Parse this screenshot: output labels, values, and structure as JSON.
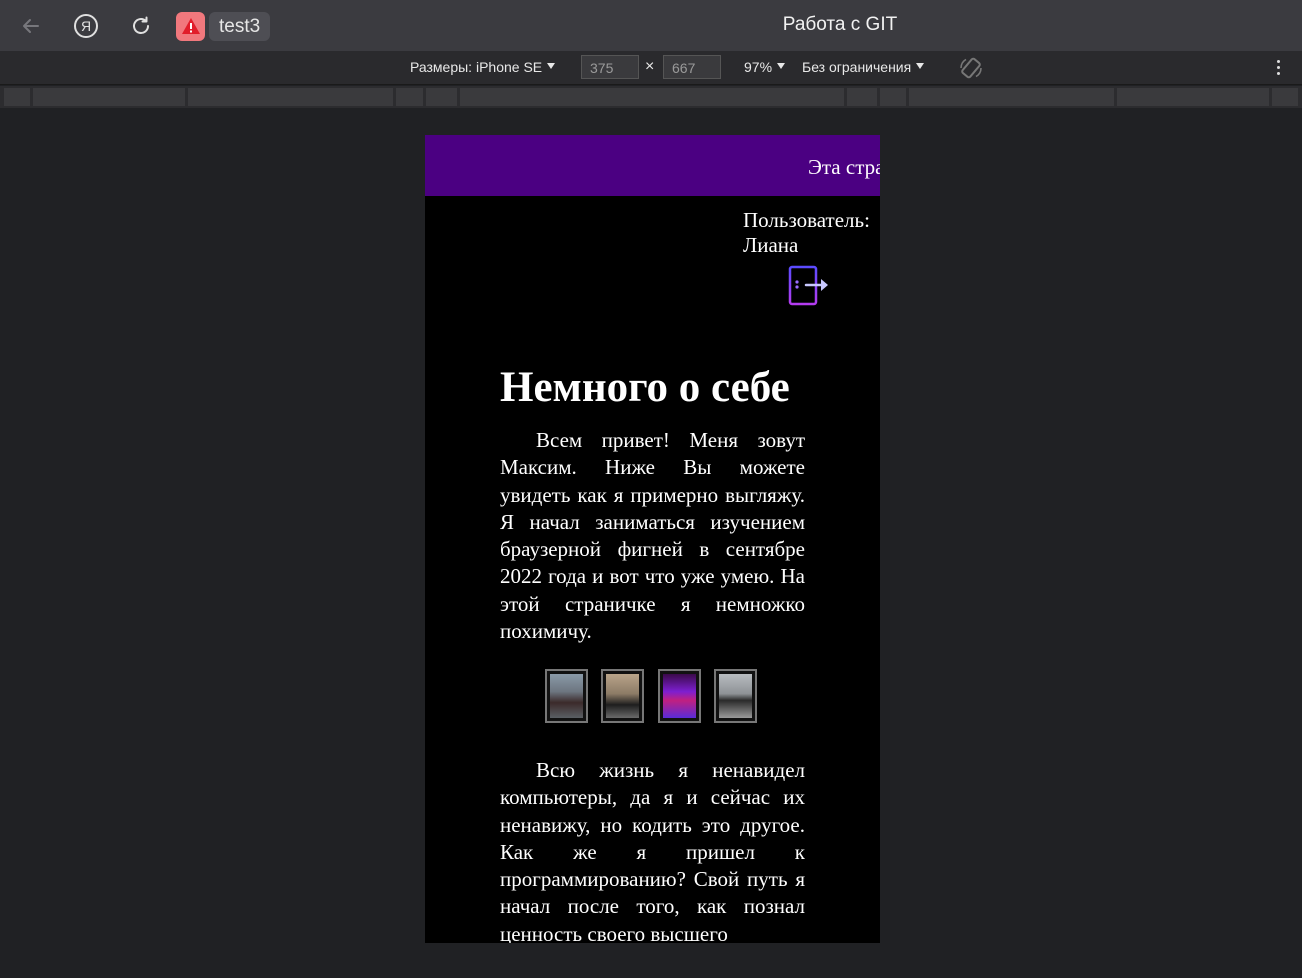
{
  "browser": {
    "tab_title": "test3",
    "page_title": "Работа с GIT"
  },
  "device_toolbar": {
    "device_label": "Размеры: iPhone SE",
    "width_value": "375",
    "height_value": "667",
    "times_sign": "×",
    "zoom_label": "97%",
    "throttle_label": "Без ограничения"
  },
  "site": {
    "marquee_text": "Эта стра",
    "user_label": "Пользователь:",
    "user_name": "Лиана",
    "heading": "Немного о себе",
    "paragraph_1": "Всем привет! Меня зовут Максим. Ниже Вы можете увидеть как я примерно выгляжу. Я начал заниматься изучением браузерной фигней в сентябре 2022 года и вот что уже умею. На этой страничке я немножко похимичу.",
    "paragraph_2": "Всю жизнь я ненавидел компьютеры, да я и сейчас их ненавижу, но кодить это другое. Как же я пришел к программированию? Свой путь я начал после того, как познал ценность своего высшего",
    "colors": {
      "header_bg": "#4b0082",
      "page_bg": "#000000",
      "text": "#ffffff"
    }
  },
  "gallery": {
    "photos": [
      {
        "name": "photo-car"
      },
      {
        "name": "photo-motorcycle"
      },
      {
        "name": "photo-purple-room"
      },
      {
        "name": "photo-street"
      }
    ]
  }
}
